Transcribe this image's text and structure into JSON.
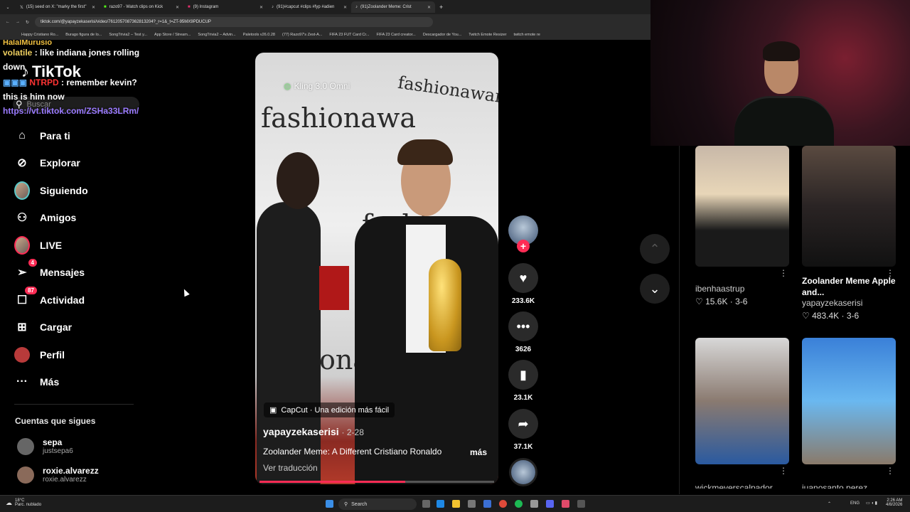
{
  "browser": {
    "tabs": [
      {
        "label": "(15) seed on X: \"marky the first\"",
        "active": false
      },
      {
        "label": "razo97 - Watch clips on Kick",
        "active": false
      },
      {
        "label": "(9) Instagram",
        "active": false
      },
      {
        "label": "(91)#capcut #clips #fyp #adien",
        "active": false
      },
      {
        "label": "(91)Zoolander Meme: Crist",
        "active": true
      }
    ],
    "new_tab": "+",
    "url": "tiktok.com/@yapayzekaserisi/video/7612057087362813204?_r=1&_t=ZT-95MX9PDUCUP",
    "bookmarks": [
      "Happy Cristiano Ro...",
      "Burago figura de lo...",
      "SongTrivia2 – Test y...",
      "App Store / Stream...",
      "SongTrivia2 – Advin...",
      "Paletools v26.0.28",
      "(77) Razo97's Zest-A...",
      "FIFA 23 FUT Card Cr...",
      "FIFA 23 Card creator...",
      "Descargador de You...",
      "Twitch Emote Resizer",
      "twitch emote re"
    ]
  },
  "chat": [
    {
      "user": "HalalMurusio",
      "text": ""
    },
    {
      "user": "volatile",
      "text": ": like indiana jones rolling down"
    },
    {
      "user": "NTRPD",
      "text": ": remember kevin? this is him now"
    },
    {
      "link": "https://vt.tiktok.com/ZSHa33LRm/"
    }
  ],
  "tiktok": {
    "logo": "TikTok",
    "search_placeholder": "Buscar",
    "nav": [
      {
        "label": "Para ti",
        "icon": "home-icon"
      },
      {
        "label": "Explorar",
        "icon": "compass-icon"
      },
      {
        "label": "Siguiendo",
        "icon": "following-avatar"
      },
      {
        "label": "Amigos",
        "icon": "friends-icon"
      },
      {
        "label": "LIVE",
        "icon": "live-avatar"
      },
      {
        "label": "Mensajes",
        "icon": "send-icon",
        "badge": "4"
      },
      {
        "label": "Actividad",
        "icon": "inbox-icon",
        "badge": "87"
      },
      {
        "label": "Cargar",
        "icon": "upload-icon"
      },
      {
        "label": "Perfil",
        "icon": "profile-avatar"
      },
      {
        "label": "Más",
        "icon": "more-icon"
      }
    ],
    "following_title": "Cuentas que sigues",
    "following": [
      {
        "name": "sepa",
        "handle": "justsepa6"
      },
      {
        "name": "roxie.alvarezz",
        "handle": "roxie.alvarezz"
      }
    ]
  },
  "video": {
    "watermark": "Kling 3.0 Omni",
    "wall_text": [
      "fashionawa",
      "fashionawards",
      "fashi",
      "ona"
    ],
    "capcut": "CapCut · Una edición más fácil",
    "username": "yapayzekaserisi",
    "date": "· 2-28",
    "description": "Zoolander Meme: A Different Cristiano Ronaldo",
    "more": "más",
    "translate": "Ver traducción",
    "progress": 0.62,
    "likes": "233.6K",
    "comments": "3626",
    "saves": "23.1K",
    "shares": "37.1K"
  },
  "related": [
    {
      "title": "",
      "user": "ibenhaastrup",
      "likes": "15.6K",
      "date": "3-6"
    },
    {
      "title": "Zoolander Meme Apple and...",
      "user": "yapayzekaserisi",
      "likes": "483.4K",
      "date": "3-6"
    },
    {
      "title": "",
      "user": "wickmeyerscalpador",
      "likes": "",
      "date": ""
    },
    {
      "title": "",
      "user": "juanosanto.perez",
      "likes": "",
      "date": ""
    }
  ],
  "taskbar": {
    "weather_temp": "18°C",
    "weather_desc": "Parc. nublado",
    "search": "Search",
    "lang": "ENG",
    "time": "2:26 AM",
    "date": "4/8/2026"
  }
}
